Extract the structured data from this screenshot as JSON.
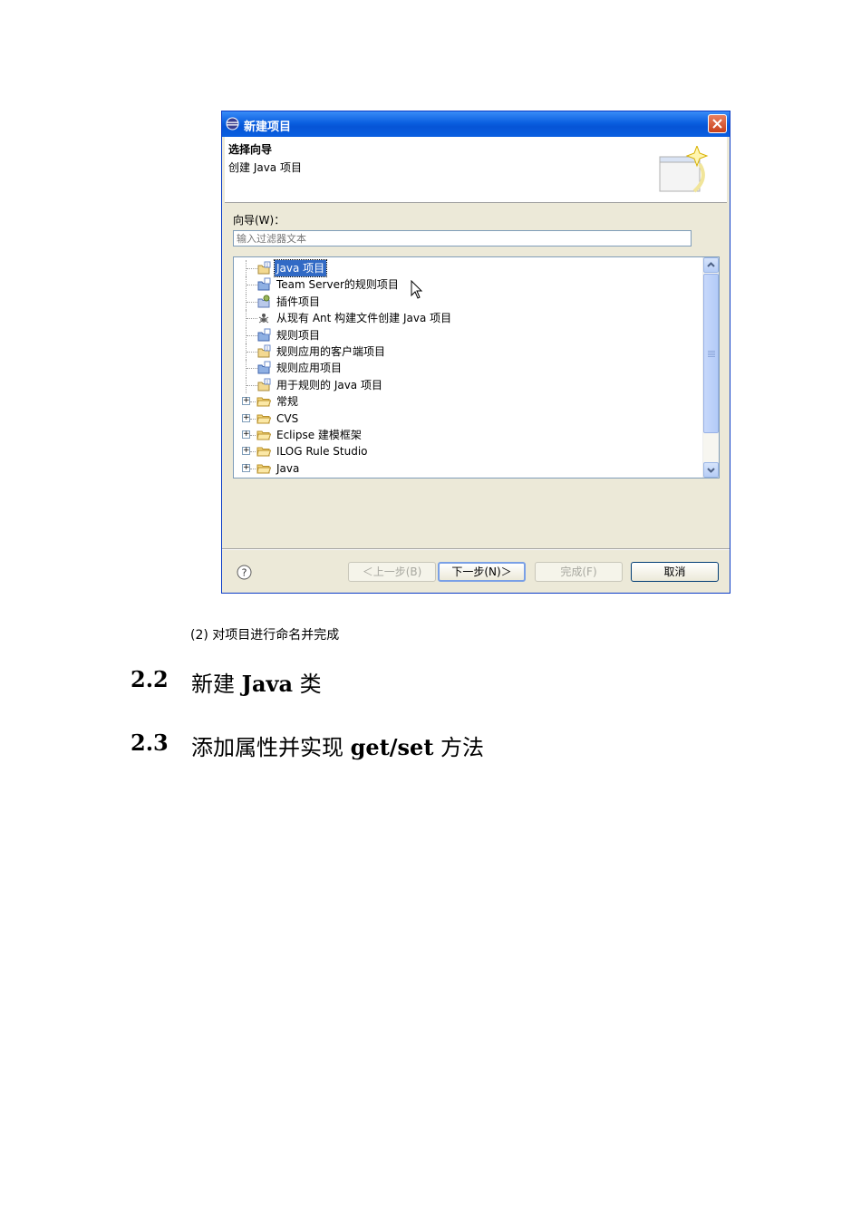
{
  "dialog": {
    "title": "新建项目",
    "banner": {
      "title": "选择向导",
      "description": "创建 Java 项目"
    },
    "wizard_label": "向导(W)：",
    "filter_placeholder": "输入过滤器文本",
    "tree": [
      {
        "label": "Java 项目",
        "selected": true,
        "expandable": false,
        "icon": "java-project-icon"
      },
      {
        "label": "Team Server的规则项目",
        "expandable": false,
        "icon": "rule-project-icon"
      },
      {
        "label": "插件项目",
        "expandable": false,
        "icon": "plugin-project-icon"
      },
      {
        "label": "从现有 Ant 构建文件创建 Java 项目",
        "expandable": false,
        "icon": "ant-icon"
      },
      {
        "label": "规则项目",
        "expandable": false,
        "icon": "rule-project-icon"
      },
      {
        "label": "规则应用的客户端项目",
        "expandable": false,
        "icon": "client-project-icon"
      },
      {
        "label": "规则应用项目",
        "expandable": false,
        "icon": "rule-app-project-icon"
      },
      {
        "label": "用于规则的 Java 项目",
        "expandable": false,
        "icon": "java-rule-project-icon"
      },
      {
        "label": "常规",
        "expandable": true,
        "icon": "folder-icon"
      },
      {
        "label": "CVS",
        "expandable": true,
        "icon": "folder-icon"
      },
      {
        "label": "Eclipse 建模框架",
        "expandable": true,
        "icon": "folder-icon"
      },
      {
        "label": "ILOG Rule Studio",
        "expandable": true,
        "icon": "folder-icon"
      },
      {
        "label": "Java",
        "expandable": true,
        "icon": "folder-icon"
      }
    ],
    "buttons": {
      "back": "＜上一步(B)",
      "next": "下一步(N)＞",
      "finish": "完成(F)",
      "cancel": "取消"
    },
    "help_icon": "?"
  },
  "document": {
    "caption": "(2)    对项目进行命名并完成",
    "headings": [
      {
        "number": "2.2",
        "prefix": "新建 ",
        "bold": "Java",
        "suffix": " 类"
      },
      {
        "number": "2.3",
        "prefix": "添加属性并实现 ",
        "bold": "get/set",
        "suffix": " 方法"
      }
    ]
  }
}
